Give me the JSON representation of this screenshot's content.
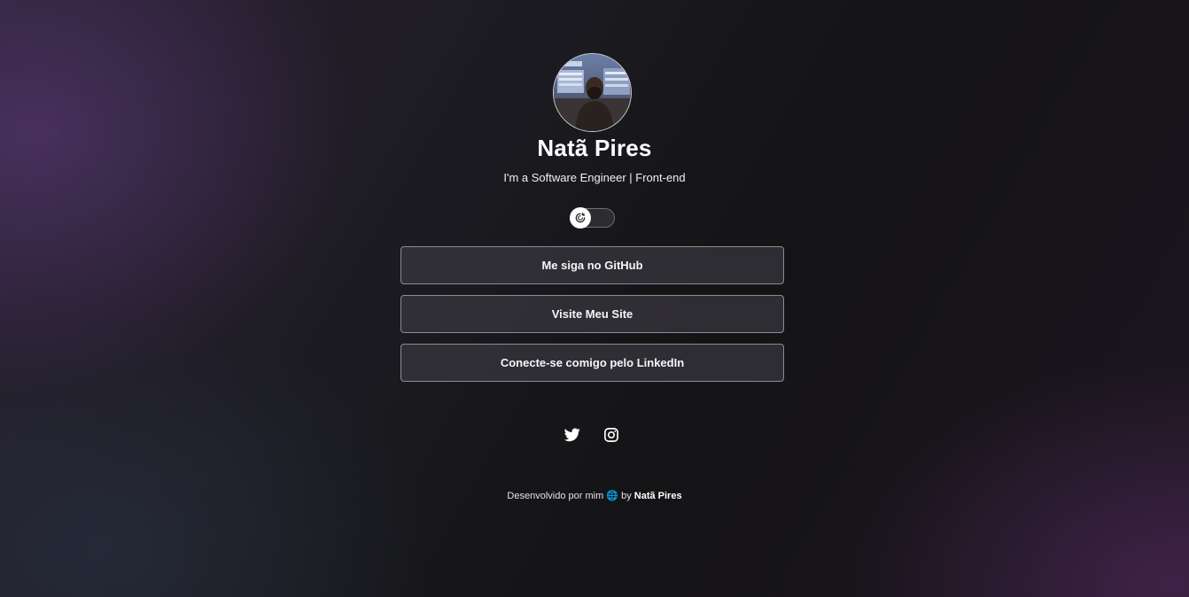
{
  "profile": {
    "name": "Natã Pires",
    "tagline": "I'm a Software Engineer | Front-end"
  },
  "theme_toggle": {
    "icon": "moon-sun-icon",
    "state": "off"
  },
  "links": [
    {
      "label": "Me siga no GitHub"
    },
    {
      "label": "Visite Meu Site"
    },
    {
      "label": "Conecte-se comigo pelo LinkedIn"
    }
  ],
  "social": {
    "twitter_icon": "twitter-icon",
    "instagram_icon": "instagram-icon"
  },
  "footer": {
    "text": "Desenvolvido por mim",
    "globe": "🌐",
    "by": "by",
    "author": "Natã Pires"
  },
  "colors": {
    "background": "#17171a",
    "accent_purple": "#623e82",
    "button_bg": "#3a3840",
    "button_border": "#8b8b92",
    "text": "#ffffff"
  }
}
